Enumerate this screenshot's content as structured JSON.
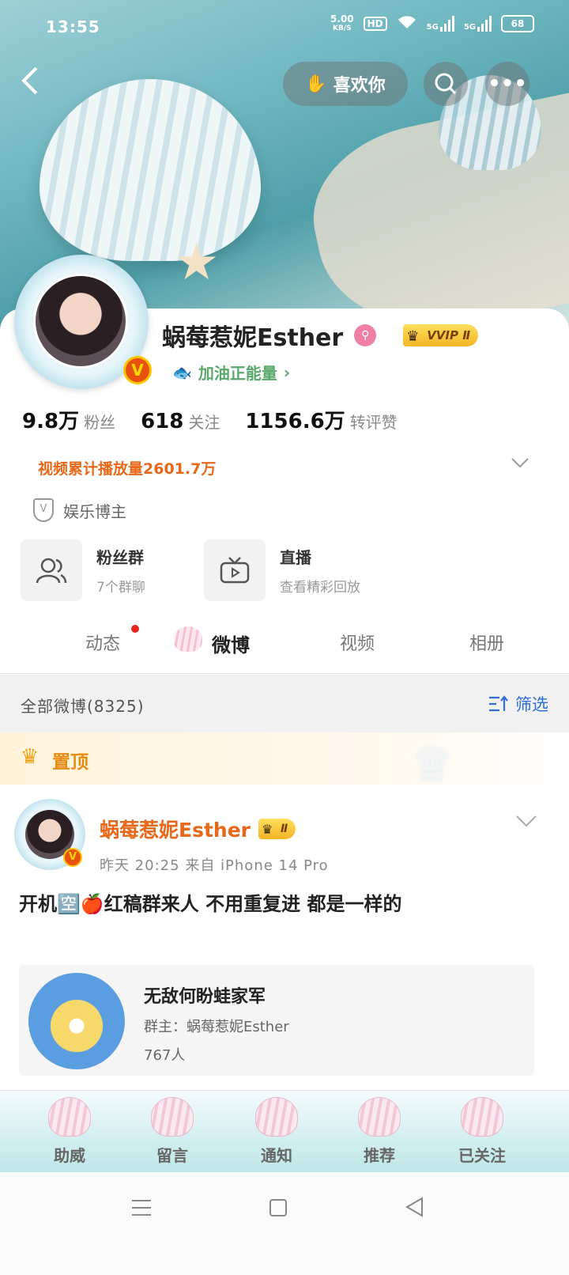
{
  "status_bar": {
    "time": "13:55",
    "net_speed_value": "5.00",
    "net_speed_unit": "KB/S",
    "hd": "HD",
    "signal1": "5G",
    "signal2": "5G",
    "battery": "68"
  },
  "header": {
    "like_label": "喜欢你"
  },
  "profile": {
    "name": "蜗莓惹妮Esther",
    "vip_label": "VVIP Ⅱ",
    "energy_label": "加油正能量",
    "stats": [
      {
        "num": "9.8万",
        "label": "粉丝"
      },
      {
        "num": "618",
        "label": "关注"
      },
      {
        "num": "1156.6万",
        "label": "转评赞"
      }
    ],
    "plays": "视频累计播放量2601.7万",
    "role": "娱乐博主",
    "features": [
      {
        "title": "粉丝群",
        "sub": "7个群聊"
      },
      {
        "title": "直播",
        "sub": "查看精彩回放"
      }
    ]
  },
  "tabs": [
    "动态",
    "微博",
    "视频",
    "相册"
  ],
  "filter": {
    "label": "全部微博(8325)",
    "button": "筛选"
  },
  "pinned": {
    "label": "置顶"
  },
  "post": {
    "author": "蜗莓惹妮Esther",
    "vip_label": "Ⅱ",
    "meta": "昨天  20:25  来自  iPhone 14 Pro",
    "text": "开机🈳🍎红稿群来人  不用重复进  都是一样的",
    "group": {
      "title": "无敌何盼蛙家军",
      "owner": "群主：蜗莓惹妮Esther",
      "count": "767人"
    }
  },
  "bottom_nav": [
    "助威",
    "留言",
    "通知",
    "推荐",
    "已关注"
  ]
}
